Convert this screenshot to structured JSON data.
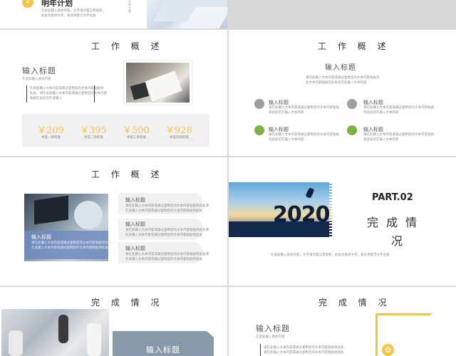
{
  "s1": {
    "badge": "4",
    "title": "明年计划",
    "desc1": "在此处输入具体内容，文字请尽量言简意赅，",
    "desc2": "此处为具体文字，表达清楚可文字主题",
    "vertical": "文字主题"
  },
  "s2": {
    "heading": "工 作 概 述",
    "title": "输入标题",
    "subtitle": "在此处输入具体内容",
    "para1": "在此处输入文本内容或通过复制您的文本内容粘贴到",
    "para2": "此处，请在此处输入文本内容或通过复制您的文本内容",
    "para3": "粘贴在此处您在此输入",
    "stats": [
      {
        "value": "￥209",
        "label": "季度一销售额"
      },
      {
        "value": "￥395",
        "label": "季度二销售额"
      },
      {
        "value": "￥500",
        "label": "季度三销售额"
      },
      {
        "value": "￥928",
        "label": "季度四销售额"
      }
    ]
  },
  "s3": {
    "heading": "工 作 概 述",
    "title": "输入标题",
    "para1": "请在此输入文本内容或通过复制您的文本内容粘贴到",
    "para2": "此文本内容粘贴在此处您在此输入文本内容",
    "items": [
      {
        "title": "输入标题",
        "l1": "请在此输入文本内容或通过复制您的文本内容粘贴",
        "l2": "到此处您在输入文本内容"
      },
      {
        "title": "输入标题",
        "l1": "请在此输入文本内容或通过复制您的文本内容粘贴",
        "l2": "到此处您在输入文本内容"
      },
      {
        "title": "输入标题",
        "l1": "请在此输入文本内容或通过复制您的文本内容粘贴",
        "l2": "到此处您在输入文本内容"
      },
      {
        "title": "输入标题",
        "l1": "请在此输入文本内容或通过复制您的文本内容粘贴",
        "l2": "到此处您在输入文本内容"
      }
    ]
  },
  "s4": {
    "heading": "工 作 概 述",
    "cards": [
      {
        "title": "输入标题",
        "l1": "请在此输入文本内容或通过复制您的文本内容粘贴到此处请",
        "l2": "在此输入文本内容或通过复制您的文本内容粘贴到此处"
      },
      {
        "title": "输入标题",
        "l1": "请在此输入文本内容或通过复制您的文本内容粘贴到此处请",
        "l2": "在此输入文本内容或通过复制您的文本内容粘贴到此处"
      },
      {
        "title": "输入标题",
        "l1": "请在此输入文本内容或通过复制您的文本内容粘贴到此处请",
        "l2": "在此输入文本内容或通过复制您的文本内容粘贴到此处"
      }
    ],
    "overlay_title": "输入标题",
    "overlay_l1": "请在此输入文本内容或通过复制您的文本内容粘贴到此处请",
    "overlay_l2": "在此输入文本内容或通过复制您的文本内容粘贴到此处"
  },
  "s5": {
    "year": "2020",
    "part": "PART.02",
    "title_l1": "完 成 情",
    "title_l2": "况",
    "caption": "在此处输入具体内容，文字请尽量言简意赅，此处为具体文字，表达清楚可文字主题"
  },
  "s6": {
    "heading": "完 成 情 况",
    "card_title": "输入标题"
  },
  "s7": {
    "heading": "完 成 情 况",
    "title": "输入标题",
    "subtitle": "在此处输入具体内容",
    "para1": "请在此输入文本内容或通过复制您的文本内容粘贴到此处，",
    "para2": "请在此输入文本内容或通过复制您的文本内容粘贴到此处"
  },
  "colors": {
    "accent": "#f6c342",
    "gray": "#8c8c8c",
    "green": "#7cb342",
    "blue": "#5a7fb8"
  }
}
